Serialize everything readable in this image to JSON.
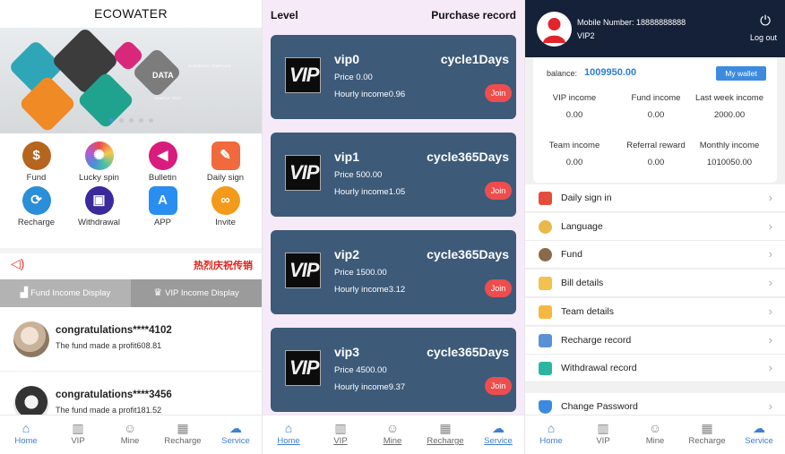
{
  "panel1": {
    "title": "ECOWATER",
    "banner": {
      "heading": "DATA",
      "sub1": "ELEMENTS TEMPLATE",
      "sub2": "SAMPLE TEXT"
    },
    "grid": [
      {
        "label": "Fund",
        "icon": "fund-icon",
        "color": "#b5651d",
        "glyph": "$"
      },
      {
        "label": "Lucky spin",
        "icon": "lucky-spin-icon",
        "color": "#e04b7a",
        "glyph": "✺"
      },
      {
        "label": "Bulletin",
        "icon": "megaphone-icon",
        "color": "#d81b7c",
        "glyph": "◀"
      },
      {
        "label": "Daily sign",
        "icon": "daily-sign-icon",
        "color": "#f06a3d",
        "glyph": "✎"
      },
      {
        "label": "Recharge",
        "icon": "recharge-icon",
        "color": "#2b8ed8",
        "glyph": "⟳"
      },
      {
        "label": "Withdrawal",
        "icon": "withdrawal-icon",
        "color": "#3a2a9c",
        "glyph": "▣"
      },
      {
        "label": "APP",
        "icon": "app-store-icon",
        "color": "#2a8df0",
        "glyph": "A"
      },
      {
        "label": "Invite",
        "icon": "invite-icon",
        "color": "#f39a1b",
        "glyph": "∞"
      }
    ],
    "notice": {
      "text": "热烈庆祝传销"
    },
    "tabs": {
      "fund": "Fund Income Display",
      "vip": "VIP Income Display"
    },
    "feed": [
      {
        "title": "congratulations****4102",
        "text": "The fund made a profit608.81"
      },
      {
        "title": "congratulations****3456",
        "text": "The fund made a profit181.52"
      }
    ]
  },
  "tabbar": {
    "items": [
      {
        "label": "Home",
        "icon": "home-icon"
      },
      {
        "label": "VIP",
        "icon": "vip-chart-icon"
      },
      {
        "label": "Mine",
        "icon": "mine-user-icon"
      },
      {
        "label": "Recharge",
        "icon": "recharge-grid-icon"
      },
      {
        "label": "Service",
        "icon": "service-icon"
      }
    ]
  },
  "panel2": {
    "header_left": "Level",
    "header_right": "Purchase record",
    "logo_text": "VIP",
    "join_label": "Join",
    "levels": [
      {
        "name": "vip0",
        "cycle": "cycle1Days",
        "price": "Price 0.00",
        "hourly": "Hourly income0.96"
      },
      {
        "name": "vip1",
        "cycle": "cycle365Days",
        "price": "Price 500.00",
        "hourly": "Hourly income1.05"
      },
      {
        "name": "vip2",
        "cycle": "cycle365Days",
        "price": "Price 1500.00",
        "hourly": "Hourly income3.12"
      },
      {
        "name": "vip3",
        "cycle": "cycle365Days",
        "price": "Price 4500.00",
        "hourly": "Hourly income9.37"
      }
    ]
  },
  "panel3": {
    "mobile_label": "Mobile Number:",
    "mobile": "18888888888",
    "level": "VIP2",
    "logout": "Log out",
    "balance_label": "balance:",
    "balance": "1009950.00",
    "wallet_button": "My wallet",
    "stats": [
      {
        "label": "VIP income",
        "value": "0.00"
      },
      {
        "label": "Fund income",
        "value": "0.00"
      },
      {
        "label": "Last week income",
        "value": "2000.00"
      },
      {
        "label": "Team income",
        "value": "0.00"
      },
      {
        "label": "Referral reward",
        "value": "0.00"
      },
      {
        "label": "Monthly income",
        "value": "1010050.00"
      }
    ],
    "menu": [
      {
        "label": "Daily sign in",
        "icon": "daily-sign-in-icon",
        "color": "#e64c3c"
      },
      {
        "label": "Language",
        "icon": "language-icon",
        "color": "#e8b84a"
      },
      {
        "label": "Fund",
        "icon": "fund-avatar-icon",
        "color": "#8a6a4a"
      },
      {
        "label": "Bill details",
        "icon": "bill-icon",
        "color": "#f2c14e"
      },
      {
        "label": "Team details",
        "icon": "team-icon",
        "color": "#f5b942"
      },
      {
        "label": "Recharge record",
        "icon": "recharge-record-icon",
        "color": "#5b8fd6"
      },
      {
        "label": "Withdrawal record",
        "icon": "withdrawal-record-icon",
        "color": "#2cb5a0"
      },
      {
        "label": "Change Password",
        "icon": "shield-icon",
        "color": "#3a8be0"
      }
    ]
  }
}
